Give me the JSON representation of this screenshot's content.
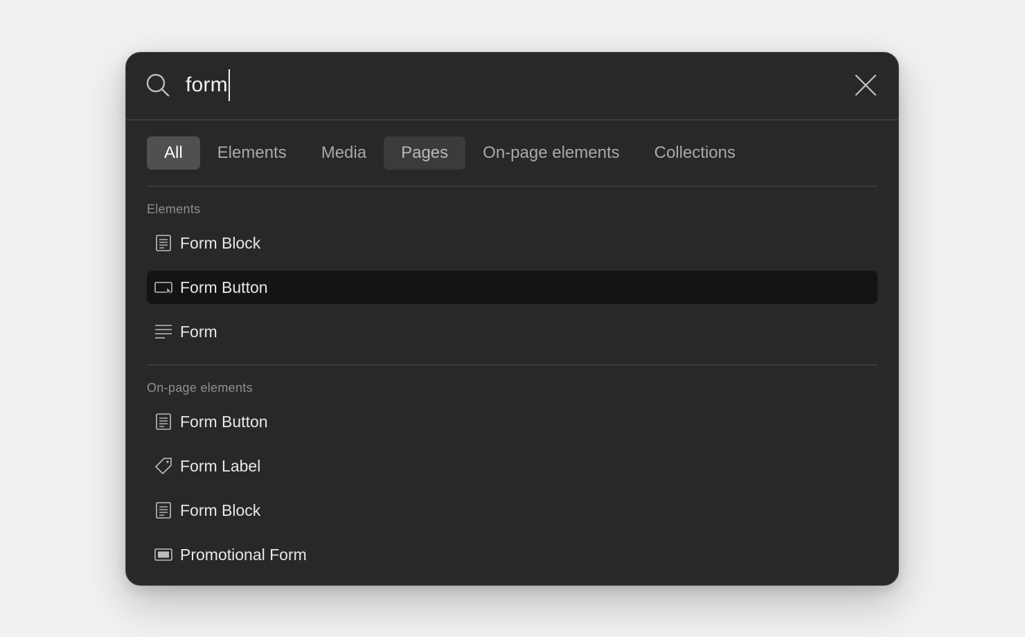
{
  "search": {
    "value": "form"
  },
  "tabs": [
    {
      "label": "All"
    },
    {
      "label": "Elements"
    },
    {
      "label": "Media"
    },
    {
      "label": "Pages"
    },
    {
      "label": "On-page elements"
    },
    {
      "label": "Collections"
    }
  ],
  "sections": {
    "elements": {
      "title": "Elements",
      "items": [
        {
          "label": "Form Block",
          "icon": "form-block-icon"
        },
        {
          "label": "Form Button",
          "icon": "form-button-icon"
        },
        {
          "label": "Form",
          "icon": "text-lines-icon"
        }
      ]
    },
    "onpage": {
      "title": "On-page elements",
      "items": [
        {
          "label": "Form Button",
          "icon": "form-block-icon"
        },
        {
          "label": "Form Label",
          "icon": "tag-icon"
        },
        {
          "label": "Form Block",
          "icon": "form-block-icon"
        },
        {
          "label": "Promotional Form",
          "icon": "promo-form-icon"
        }
      ]
    }
  },
  "colors": {
    "background": "#f1f1f1",
    "dialog": "#282828",
    "active_tab": "#505050",
    "selected_row": "#141414"
  }
}
